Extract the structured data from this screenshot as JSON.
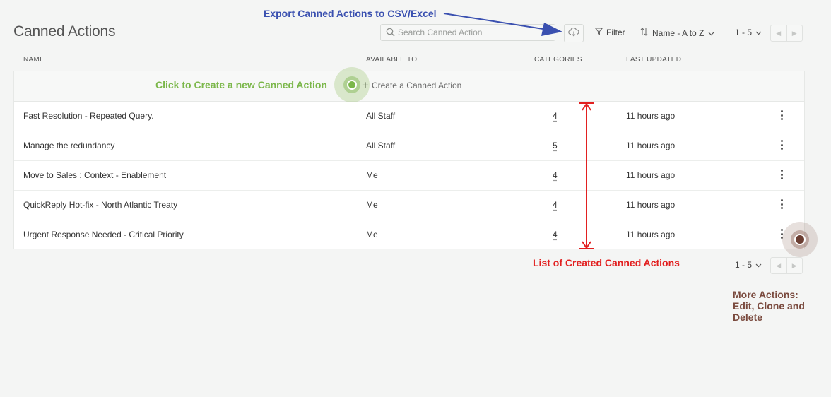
{
  "page": {
    "title": "Canned Actions"
  },
  "toolbar": {
    "search_placeholder": "Search Canned Action",
    "filter_label": "Filter",
    "sort_label": "Name - A to Z",
    "pager_top": "1 - 5",
    "pager_bottom": "1 - 5"
  },
  "table": {
    "headers": {
      "name": "NAME",
      "available_to": "AVAILABLE TO",
      "categories": "CATEGORIES",
      "last_updated": "LAST UPDATED"
    },
    "create_label": "Create a Canned Action",
    "rows": [
      {
        "name": "Fast Resolution - Repeated Query.",
        "available_to": "All Staff",
        "categories": "4",
        "last_updated": "11 hours ago"
      },
      {
        "name": "Manage the redundancy",
        "available_to": "All Staff",
        "categories": "5",
        "last_updated": "11 hours ago"
      },
      {
        "name": "Move to Sales : Context - Enablement",
        "available_to": "Me",
        "categories": "4",
        "last_updated": "11 hours ago"
      },
      {
        "name": "QuickReply Hot-fix - North Atlantic Treaty",
        "available_to": "Me",
        "categories": "4",
        "last_updated": "11 hours ago"
      },
      {
        "name": "Urgent Response Needed - Critical Priority",
        "available_to": "Me",
        "categories": "4",
        "last_updated": "11 hours ago"
      }
    ]
  },
  "annotations": {
    "export": "Export Canned Actions to CSV/Excel",
    "create": "Click to Create a new Canned Action",
    "list": "List of Created Canned Actions",
    "more_line1": "More Actions:",
    "more_line2": "Edit, Clone and",
    "more_line3": "Delete"
  },
  "icons": [
    "search-icon",
    "cloud-download-icon",
    "filter-icon",
    "sort-icon",
    "chevron-down-icon",
    "chevron-left-icon",
    "chevron-right-icon",
    "plus-icon",
    "kebab-menu-icon"
  ],
  "colors": {
    "annotation_blue": "#3a50b0",
    "annotation_green": "#7bb74a",
    "annotation_red": "#e22020",
    "annotation_brown": "#7a4a3e"
  }
}
